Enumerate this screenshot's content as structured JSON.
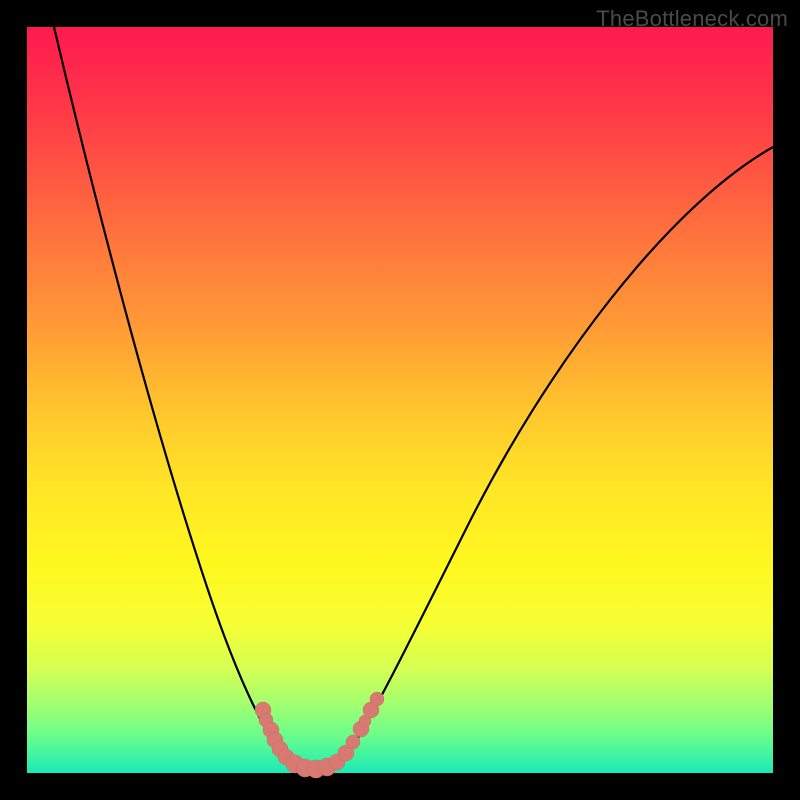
{
  "watermark": "TheBottleneck.com",
  "colors": {
    "gradient_top": "#ff1a4e",
    "gradient_mid": "#ffe626",
    "gradient_bottom": "#1ae9b8",
    "curve": "#000000",
    "beads": "#d87a72",
    "frame": "#000000"
  },
  "chart_data": {
    "type": "line",
    "title": "",
    "xlabel": "",
    "ylabel": "",
    "xlim": [
      0,
      100
    ],
    "ylim": [
      0,
      100
    ],
    "grid": false,
    "legend": false,
    "note": "Bottleneck-style V curve. x is relative horizontal position (% of plot width), y is bottleneck metric (0 = best/green bottom, 100 = worst/red top). Values estimated from pixel positions; no numeric axes are shown.",
    "series": [
      {
        "name": "bottleneck-curve",
        "x": [
          3.6,
          10,
          16,
          21,
          26,
          30,
          33,
          36,
          38.5,
          40,
          42,
          45,
          50,
          58,
          70,
          85,
          100
        ],
        "y": [
          100,
          80,
          60,
          42,
          28,
          16,
          8,
          3,
          0.5,
          0.4,
          3,
          10,
          22,
          38,
          58,
          77,
          84
        ]
      }
    ],
    "highlight_points": {
      "name": "beads",
      "x": [
        31.6,
        32.0,
        32.7,
        33.2,
        33.9,
        34.7,
        35.9,
        37.3,
        38.7,
        40.2,
        41.6,
        42.8,
        43.7,
        44.8,
        45.3,
        46.1,
        46.9
      ],
      "y": [
        8.4,
        7.1,
        5.8,
        4.4,
        3.2,
        2.1,
        1.2,
        0.7,
        0.5,
        0.8,
        1.5,
        2.7,
        4.2,
        5.9,
        7.0,
        8.4,
        9.9
      ]
    }
  }
}
